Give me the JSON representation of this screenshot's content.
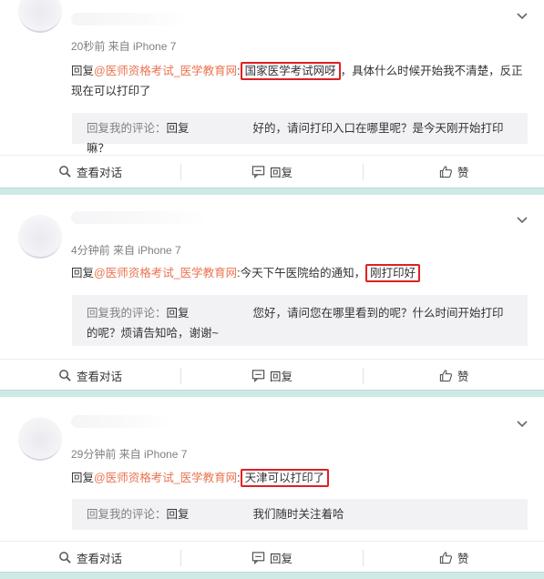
{
  "posts": [
    {
      "meta": "20秒前 来自 iPhone 7",
      "reply_prefix": "回复",
      "mention": "@医师资格考试_医学教育网",
      "colon": ":",
      "highlight": "国家医学考试网呀",
      "reply_rest": "，具体什么时候开始我不清楚，反正现在可以打印了",
      "quote_label": "回复我的评论：",
      "quote_prefix": "回复",
      "quote_text": "好的，请问打印入口在哪里呢？是今天刚开始打印嘛？"
    },
    {
      "meta": "4分钟前 来自 iPhone 7",
      "reply_prefix": "回复",
      "mention": "@医师资格考试_医学教育网",
      "colon": ":",
      "reply_text_before": "今天下午医院给的通知，",
      "highlight": "刚打印好",
      "quote_label": "回复我的评论：",
      "quote_prefix": "回复",
      "quote_text": "您好，请问您在哪里看到的呢？什么时间开始打印的呢？烦请告知哈，谢谢~"
    },
    {
      "meta": "29分钟前 来自 iPhone 7",
      "reply_prefix": "回复",
      "mention": "@医师资格考试_医学教育网",
      "colon": ":",
      "highlight": "天津可以打印了",
      "quote_label": "回复我的评论：",
      "quote_prefix": "回复",
      "quote_text": "我们随时关注着哈"
    }
  ],
  "actions": {
    "view_conversation": "查看对话",
    "reply": "回复",
    "like": "赞"
  },
  "colors": {
    "mention": "#eb7350",
    "highlight_border": "#e02020",
    "separator": "#cfe9e5"
  }
}
